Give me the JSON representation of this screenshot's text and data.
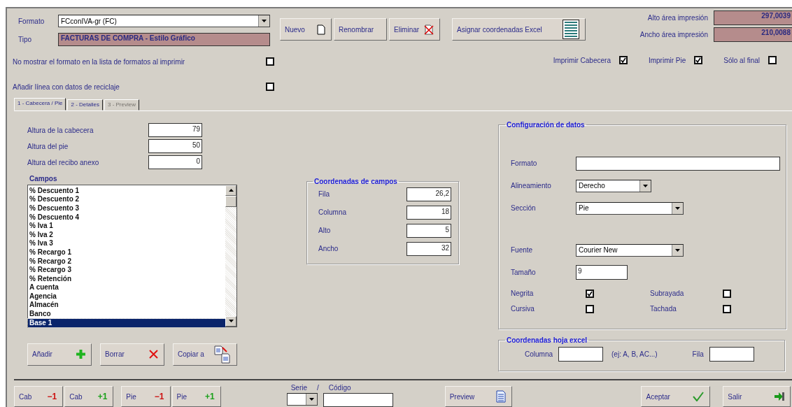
{
  "format_field": {
    "label": "Formato",
    "value": "FCconIVA-gr (FC)"
  },
  "type_field": {
    "label": "Tipo",
    "value": "FACTURAS DE COMPRA - Estilo Gráfico"
  },
  "options": [
    {
      "label": "No mostrar el formato en la lista de formatos al imprimir",
      "checked": false
    },
    {
      "label": "Añadir línea con datos de reciclaje",
      "checked": false
    }
  ],
  "toolbar": [
    {
      "label": "Nuevo",
      "kind": "new"
    },
    {
      "label": "Renombrar",
      "kind": "rename"
    },
    {
      "label": "Eliminar",
      "kind": "delete"
    },
    {
      "label": "Asignar coordenadas Excel",
      "kind": "excel"
    }
  ],
  "print_area": [
    {
      "label": "Alto área impresión",
      "value": "297,0039"
    },
    {
      "label": "Ancho área impresión",
      "value": "210,0088"
    }
  ],
  "print_flags": [
    {
      "label": "Imprimir Cabecera",
      "checked": true
    },
    {
      "label": "Imprimir Pie",
      "checked": true
    },
    {
      "label": "Sólo al final",
      "checked": false
    }
  ],
  "tabs": [
    {
      "label": "1 - Cabecera / Pie",
      "selected": true,
      "disabled": false
    },
    {
      "label": "2 - Detalles",
      "selected": false,
      "disabled": false
    },
    {
      "label": "3 - Preview",
      "selected": false,
      "disabled": true
    }
  ],
  "heights": [
    {
      "label": "Altura de la cabecera",
      "value": "79"
    },
    {
      "label": "Altura del pie",
      "value": "50"
    },
    {
      "label": "Altura del recibo anexo",
      "value": "0"
    }
  ],
  "fields_list": {
    "title": "Campos",
    "items": [
      {
        "label": "% Descuento 1",
        "selected": false
      },
      {
        "label": "% Descuento 2",
        "selected": false
      },
      {
        "label": "% Descuento 3",
        "selected": false
      },
      {
        "label": "% Descuento 4",
        "selected": false
      },
      {
        "label": "% Iva 1",
        "selected": false
      },
      {
        "label": "% Iva 2",
        "selected": false
      },
      {
        "label": "% Iva 3",
        "selected": false
      },
      {
        "label": "% Recargo 1",
        "selected": false
      },
      {
        "label": "% Recargo 2",
        "selected": false
      },
      {
        "label": "% Recargo 3",
        "selected": false
      },
      {
        "label": "% Retención",
        "selected": false
      },
      {
        "label": "A cuenta",
        "selected": false
      },
      {
        "label": "Agencia",
        "selected": false
      },
      {
        "label": "Almacén",
        "selected": false
      },
      {
        "label": "Banco",
        "selected": false
      },
      {
        "label": "Base 1",
        "selected": true
      }
    ]
  },
  "list_buttons": [
    {
      "label": "Añadir",
      "kind": "add"
    },
    {
      "label": "Borrar",
      "kind": "delete"
    },
    {
      "label": "Copiar a",
      "kind": "copy"
    }
  ],
  "field_coords": {
    "title": "Coordenadas de campos",
    "rows": [
      {
        "label": "Fila",
        "value": "26,2"
      },
      {
        "label": "Columna",
        "value": "18"
      },
      {
        "label": "Alto",
        "value": "5"
      },
      {
        "label": "Ancho",
        "value": "32"
      }
    ]
  },
  "data_config": {
    "title": "Configuración de datos",
    "format": {
      "label": "Formato"
    },
    "alignment": {
      "label": "Alineamiento",
      "value": "Derecho"
    },
    "section": {
      "label": "Sección",
      "value": "Pie"
    },
    "font": {
      "label": "Fuente",
      "value": "Courier New"
    },
    "size": {
      "label": "Tamaño",
      "value": "9"
    },
    "styles": [
      {
        "label": "Negrita",
        "checked": true
      },
      {
        "label": "Subrayada",
        "checked": false
      },
      {
        "label": "Cursiva",
        "checked": false
      },
      {
        "label": "Tachada",
        "checked": false
      }
    ]
  },
  "excel_coords": {
    "title": "Coordenadas hoja excel",
    "column_label": "Columna",
    "hint": "(ej: A, B, AC...)",
    "row_label": "Fila"
  },
  "bottom_buttons": [
    {
      "label": "Cab",
      "step": "−1",
      "kind": "minus"
    },
    {
      "label": "Cab",
      "step": "+1",
      "kind": "plus"
    },
    {
      "label": "Pie",
      "step": "−1",
      "kind": "minus"
    },
    {
      "label": "Pie",
      "step": "+1",
      "kind": "plus"
    }
  ],
  "series_code": {
    "series_label": "Serie",
    "separator": "/",
    "code_label": "Código"
  },
  "preview_button": {
    "label": "Preview"
  },
  "actions": [
    {
      "label": "Aceptar",
      "kind": "accept"
    },
    {
      "label": "Salir",
      "kind": "exit"
    }
  ]
}
